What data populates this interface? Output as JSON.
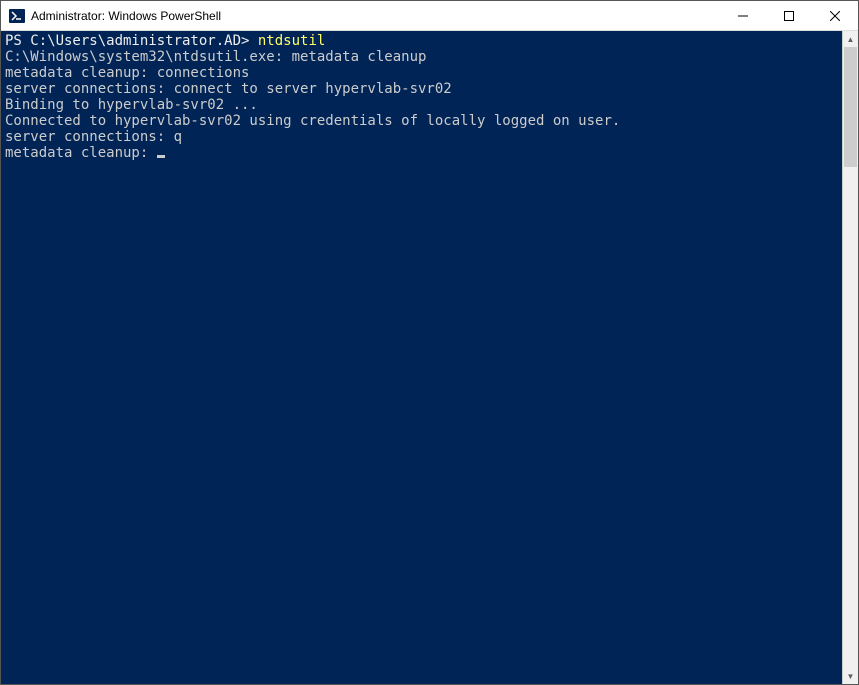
{
  "window": {
    "title": "Administrator: Windows PowerShell"
  },
  "terminal": {
    "prompt_prefix": "PS C:\\Users\\administrator.AD> ",
    "prompt_command": "ntdsutil",
    "lines": {
      "l1": "C:\\Windows\\system32\\ntdsutil.exe: metadata cleanup",
      "l2": "metadata cleanup: connections",
      "l3": "server connections: connect to server hypervlab-svr02",
      "l4": "Binding to hypervlab-svr02 ...",
      "l5": "Connected to hypervlab-svr02 using credentials of locally logged on user.",
      "l6": "server connections: q",
      "l7": "metadata cleanup: "
    }
  },
  "colors": {
    "terminal_bg": "#012456",
    "text": "#cccccc",
    "prompt_white": "#eeeeee",
    "command_yellow": "#ffff66"
  }
}
